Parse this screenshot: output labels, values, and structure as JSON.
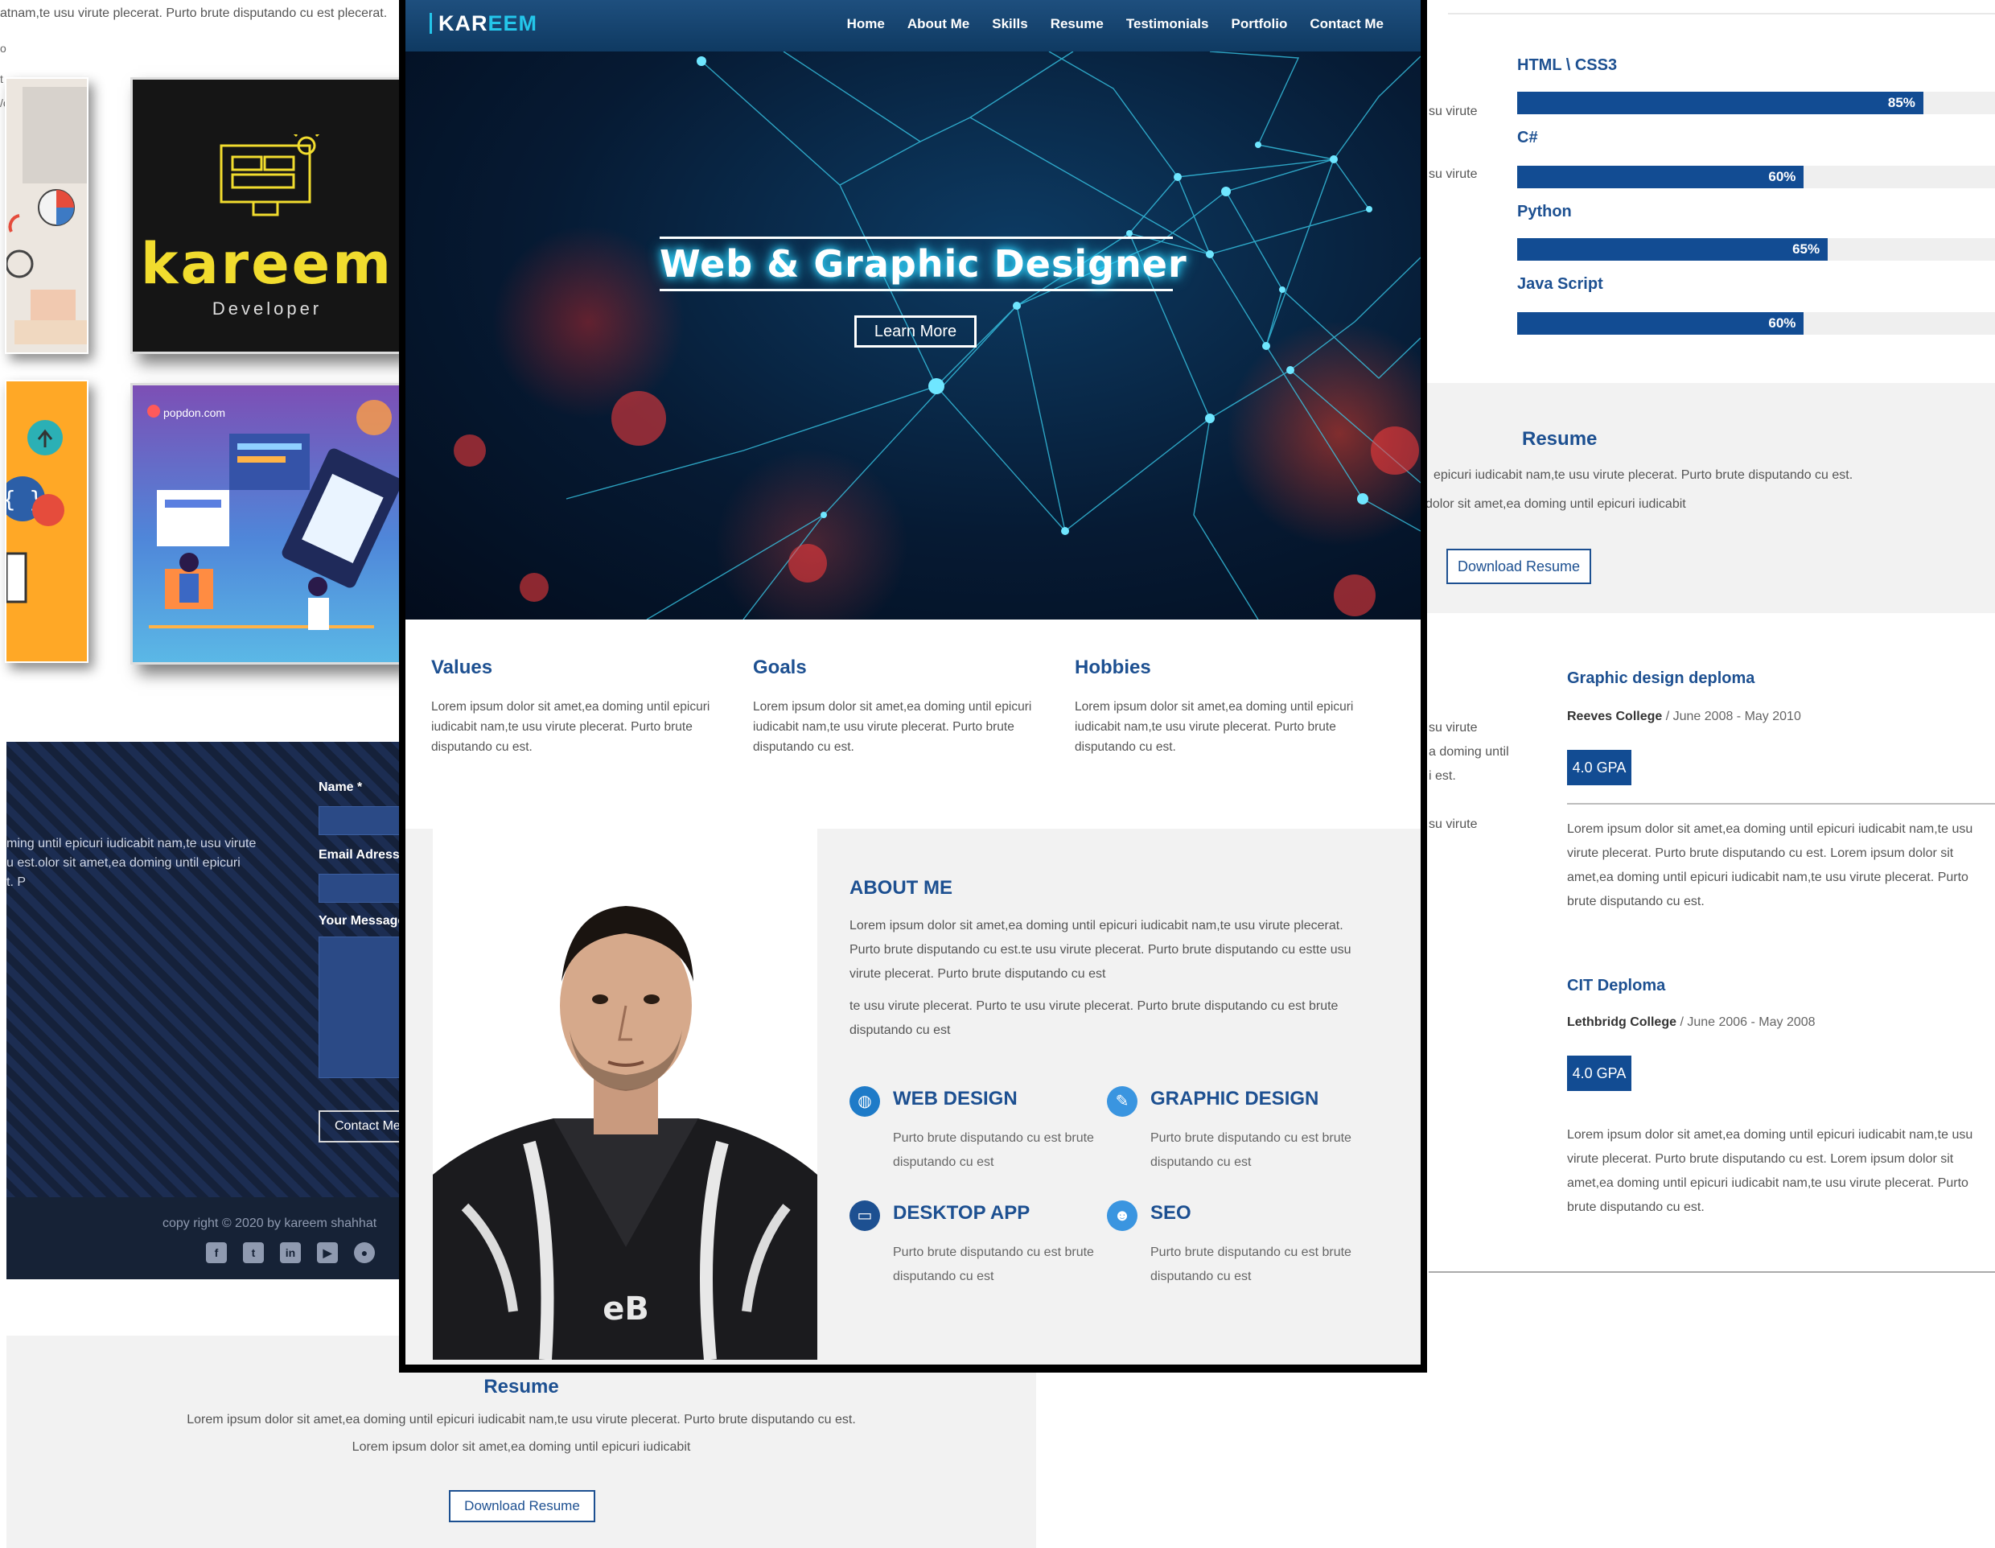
{
  "left": {
    "top_text": "atnam,te usu virute plecerat. Purto brute disputando cu est plecerat.",
    "edge_letters": [
      "o",
      "t",
      "/c"
    ],
    "kareem_card": {
      "word": "kareem",
      "sub": "Developer"
    },
    "popdon_card": {
      "label": "popdon.com"
    },
    "contact": {
      "lines": [
        "ming until epicuri iudicabit nam,te usu virute",
        "u est.olor sit amet,ea doming until epicuri",
        "t. P"
      ],
      "name_label": "Name *",
      "email_label": "Email Adress",
      "message_label": "Your Message",
      "button": "Contact Me",
      "copyright": "copy right © 2020 by kareem shahhat",
      "socials": [
        "facebook-icon",
        "twitter-icon",
        "linkedin-icon",
        "youtube-icon",
        "github-icon"
      ]
    },
    "resume": {
      "title": "Resume",
      "p1": "Lorem ipsum dolor sit amet,ea doming until epicuri iudicabit nam,te usu virute plecerat. Purto brute disputando cu est.",
      "p2": "Lorem ipsum dolor sit amet,ea doming until epicuri iudicabit",
      "button": "Download Resume"
    }
  },
  "main": {
    "brand": {
      "part1": "KAR",
      "part2": "EEM"
    },
    "nav": [
      "Home",
      "About Me",
      "Skills",
      "Resume",
      "Testimonials",
      "Portfolio",
      "Contact Me"
    ],
    "hero": {
      "title": "Web & Graphic Designer",
      "button": "Learn More"
    },
    "columns": [
      {
        "title": "Values",
        "text": "Lorem ipsum dolor sit amet,ea doming until epicuri iudicabit nam,te usu virute plecerat. Purto brute disputando cu est."
      },
      {
        "title": "Goals",
        "text": "Lorem ipsum dolor sit amet,ea doming until epicuri iudicabit nam,te usu virute plecerat. Purto brute disputando cu est."
      },
      {
        "title": "Hobbies",
        "text": "Lorem ipsum dolor sit amet,ea doming until epicuri iudicabit nam,te usu virute plecerat. Purto brute disputando cu est."
      }
    ],
    "about": {
      "title": "ABOUT ME",
      "p1": "Lorem ipsum dolor sit amet,ea doming until epicuri iudicabit nam,te usu virute plecerat. Purto brute disputando cu est.te usu virute plecerat. Purto brute disputando cu estte usu virute plecerat. Purto brute disputando cu est",
      "p2": "te usu virute plecerat. Purto te usu virute plecerat. Purto brute disputando cu est brute disputando cu est",
      "services": [
        {
          "icon": "globe-icon",
          "title": "WEB DESIGN",
          "text": "Purto brute disputando cu est brute disputando cu est"
        },
        {
          "icon": "pencil-icon",
          "title": "GRAPHIC DESIGN",
          "text": "Purto brute disputando cu est brute disputando cu est"
        },
        {
          "icon": "monitor-icon",
          "title": "DESKTOP APP",
          "text": "Purto brute disputando cu est brute disputando cu est"
        },
        {
          "icon": "users-icon",
          "title": "SEO",
          "text": "Purto brute disputando cu est brute disputando cu est"
        }
      ]
    }
  },
  "right": {
    "skills": [
      {
        "label": "HTML \\ CSS3",
        "value": 85,
        "pct": "85%"
      },
      {
        "label": "C#",
        "value": 60,
        "pct": "60%"
      },
      {
        "label": "Python",
        "value": 65,
        "pct": "65%"
      },
      {
        "label": "Java Script",
        "value": 60,
        "pct": "60%"
      }
    ],
    "cut_texts": [
      "su virute",
      "su virute",
      "su virute",
      "a doming until",
      "i est.",
      "su virute"
    ],
    "resume": {
      "title": "Resume",
      "p1": "epicuri iudicabit nam,te usu virute plecerat. Purto brute disputando cu est.",
      "p2": "dolor sit amet,ea doming until epicuri iudicabit",
      "button": "Download Resume"
    },
    "education": [
      {
        "title": "Graphic design deploma",
        "school": "Reeves College",
        "dates": "/ June 2008 - May 2010",
        "gpa": "4.0 GPA",
        "text": "Lorem ipsum dolor sit amet,ea doming until epicuri iudicabit nam,te usu virute plecerat. Purto brute disputando cu est. Lorem ipsum dolor sit amet,ea doming until epicuri iudicabit nam,te usu virute plecerat. Purto brute disputando cu est."
      },
      {
        "title": "CIT Deploma",
        "school": "Lethbridg College",
        "dates": "/ June 2006 - May 2008",
        "gpa": "4.0 GPA",
        "text": "Lorem ipsum dolor sit amet,ea doming until epicuri iudicabit nam,te usu virute plecerat. Purto brute disputando cu est. Lorem ipsum dolor sit amet,ea doming until epicuri iudicabit nam,te usu virute plecerat. Purto brute disputando cu est."
      }
    ]
  },
  "colors": {
    "brand_blue": "#1d5091",
    "bar_blue": "#124c93",
    "accent_cyan": "#24c6ea",
    "yellow": "#f1dc2e"
  }
}
